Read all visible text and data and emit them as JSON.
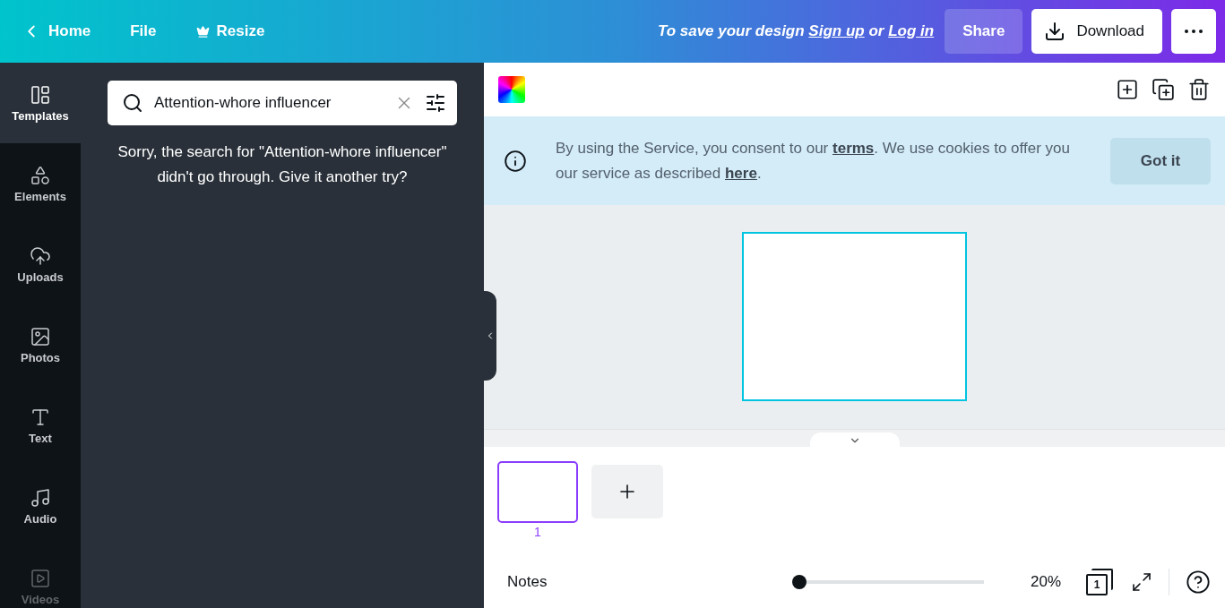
{
  "top_bar": {
    "nav": [
      {
        "label": "Home",
        "kind": "back"
      },
      {
        "label": "File",
        "kind": "plain"
      },
      {
        "label": "Resize",
        "kind": "premium"
      }
    ],
    "save_prompt": [
      {
        "kind": "text",
        "text": "To save your design"
      },
      {
        "kind": "link",
        "text": "Sign up"
      },
      {
        "kind": "text",
        "text": "or"
      },
      {
        "kind": "link",
        "text": "Log in"
      }
    ],
    "share": "Share",
    "download": "Download"
  },
  "sidebar": {
    "items": [
      {
        "label": "Templates",
        "selected": true
      },
      {
        "label": "Elements",
        "selected": false
      },
      {
        "label": "Uploads",
        "selected": false
      },
      {
        "label": "Photos",
        "selected": false
      },
      {
        "label": "Text",
        "selected": false
      },
      {
        "label": "Audio",
        "selected": false
      },
      {
        "label": "Videos",
        "selected": false
      }
    ]
  },
  "search_panel": {
    "query": "Attention-whore influencer",
    "message": "Sorry, the search for \"Attention-whore influencer\" didn't go through. Give it another try?"
  },
  "cookie_banner": {
    "segments": [
      {
        "kind": "text",
        "text": "By using the Service, you consent to our "
      },
      {
        "kind": "link",
        "text": "terms"
      },
      {
        "kind": "text",
        "text": ". We use cookies to offer you our service as described "
      },
      {
        "kind": "link",
        "text": "here"
      },
      {
        "kind": "text",
        "text": "."
      }
    ],
    "button": "Got it"
  },
  "pages": [
    {
      "number": "1",
      "selected": true
    }
  ],
  "footer": {
    "notes": "Notes",
    "zoom": {
      "level": 0.0,
      "reading": "20%"
    },
    "page_count": "1"
  }
}
